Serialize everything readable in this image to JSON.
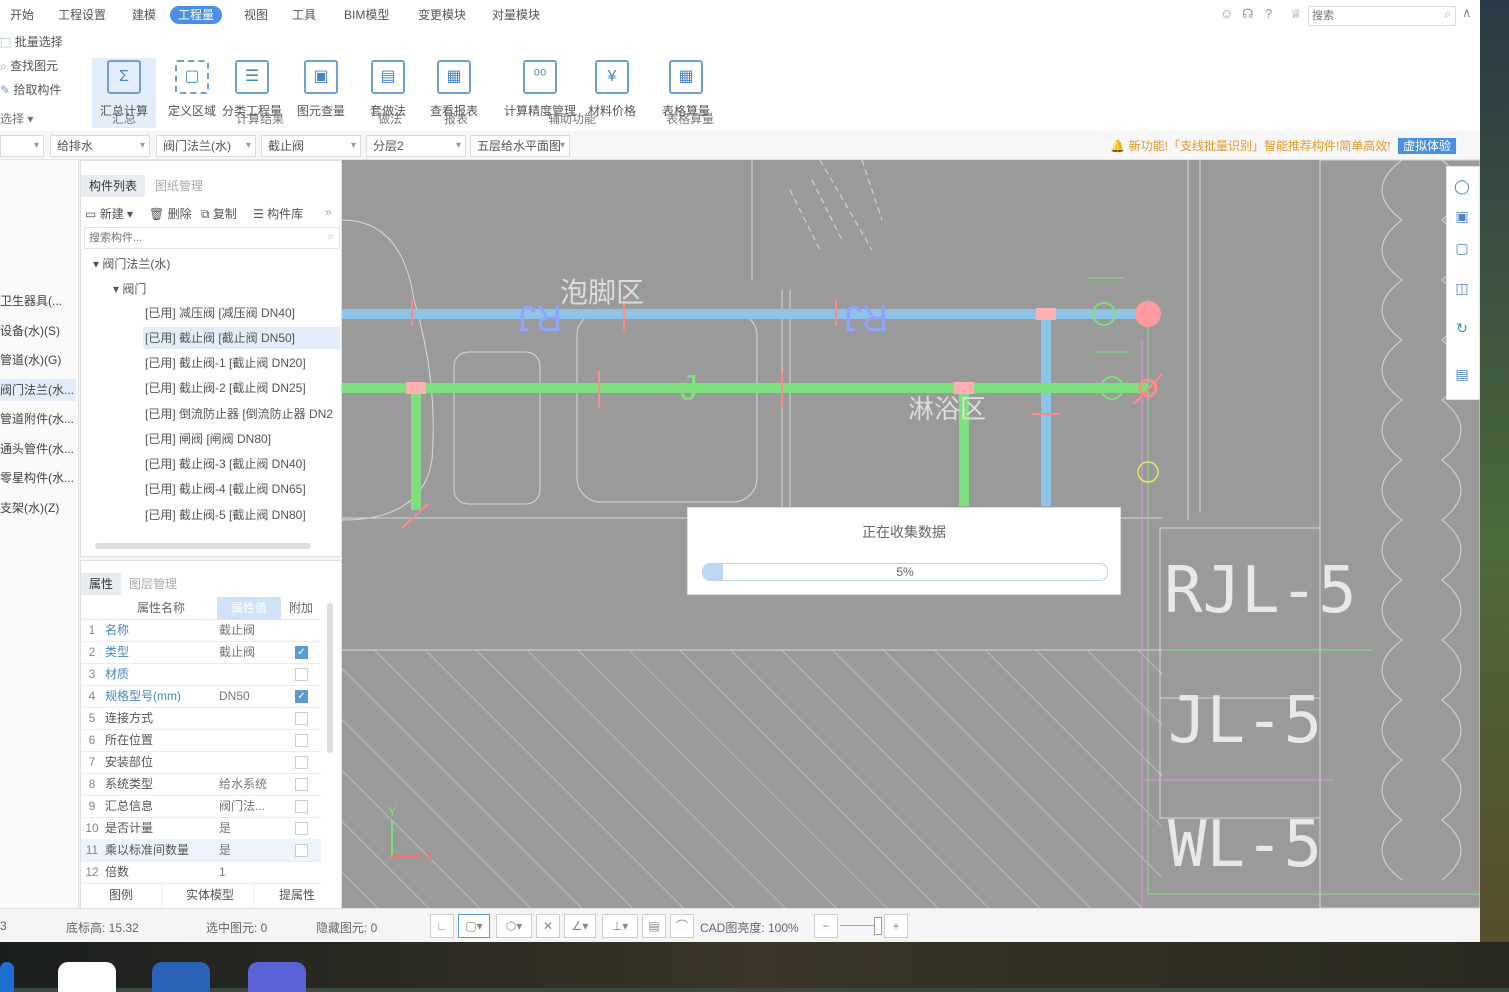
{
  "menu": [
    "开始",
    "工程设置",
    "建模",
    "工程量",
    "视图",
    "工具",
    "BIM模型",
    "变更模块",
    "对量模块"
  ],
  "active_menu": "工程量",
  "top_right": {
    "search_placeholder": "搜索",
    "icons": [
      "user-icon",
      "headset-icon",
      "help-icon",
      "skin-icon",
      "collapse-icon"
    ]
  },
  "ribbon": {
    "left_actions": [
      "批量选择",
      "查找图元",
      "拾取构件"
    ],
    "left_group": "选择",
    "buttons": [
      {
        "label": "汇总计算",
        "icon": "sigma-icon",
        "glyph": "Σ",
        "selected": true
      },
      {
        "label": "定义区域",
        "icon": "dashed-region-icon",
        "glyph": "▢",
        "selected": false
      },
      {
        "label": "分类工程量",
        "icon": "list-icon",
        "glyph": "☰",
        "selected": false
      },
      {
        "label": "图元查量",
        "icon": "element-query-icon",
        "glyph": "▣",
        "selected": false
      },
      {
        "label": "套做法",
        "icon": "method-icon",
        "glyph": "▤",
        "selected": false
      },
      {
        "label": "查看报表",
        "icon": "report-icon",
        "glyph": "▦",
        "selected": false
      },
      {
        "label": "计算精度管理",
        "icon": "precision-icon",
        "glyph": "⁰⁰",
        "selected": false
      },
      {
        "label": "材料价格",
        "icon": "price-icon",
        "glyph": "¥",
        "selected": false
      },
      {
        "label": "表格算量",
        "icon": "table-icon",
        "glyph": "▦",
        "selected": false
      }
    ],
    "groups": [
      "汇总",
      "计算结果",
      "做法",
      "报表",
      "辅助功能",
      "表格算量"
    ]
  },
  "filters": [
    "给排水",
    "阀门法兰(水)",
    "截止阀",
    "分层2",
    "五层给水平面图"
  ],
  "notice": {
    "text": "新功能!「支线批量识别」智能推荐构件!简单高效!",
    "button": "虚拟体验"
  },
  "nav_items": [
    {
      "label": "卫生器具(...",
      "active": false
    },
    {
      "label": "设备(水)(S)",
      "active": false
    },
    {
      "label": "管道(水)(G)",
      "active": false
    },
    {
      "label": "阀门法兰(水...",
      "active": true
    },
    {
      "label": "管道附件(水...",
      "active": false
    },
    {
      "label": "通头管件(水...",
      "active": false
    },
    {
      "label": "零星构件(水...",
      "active": false
    },
    {
      "label": "支架(水)(Z)",
      "active": false
    }
  ],
  "component_panel": {
    "tabs": [
      "构件列表",
      "图纸管理"
    ],
    "tools": [
      "新建",
      "删除",
      "复制",
      "构件库"
    ],
    "search_placeholder": "搜索构件...",
    "tree_root": "阀门法兰(水)",
    "tree_child": "阀门",
    "items": [
      {
        "label": "[已用] 减压阀 [减压阀 DN40]",
        "selected": false
      },
      {
        "label": "[已用] 截止阀 [截止阀 DN50]",
        "selected": true
      },
      {
        "label": "[已用] 截止阀-1 [截止阀 DN20]",
        "selected": false
      },
      {
        "label": "[已用] 截止阀-2 [截止阀 DN25]",
        "selected": false
      },
      {
        "label": "[已用] 倒流防止器 [倒流防止器 DN2",
        "selected": false
      },
      {
        "label": "[已用] 闸阀 [闸阀 DN80]",
        "selected": false
      },
      {
        "label": "[已用] 截止阀-3 [截止阀 DN40]",
        "selected": false
      },
      {
        "label": "[已用] 截止阀-4 [截止阀 DN65]",
        "selected": false
      },
      {
        "label": "[已用] 截止阀-5 [截止阀 DN80]",
        "selected": false
      }
    ]
  },
  "properties": {
    "tabs": [
      "属性",
      "图层管理"
    ],
    "headers": [
      "属性名称",
      "属性值",
      "附加"
    ],
    "rows": [
      {
        "n": "1",
        "key": "名称",
        "val": "截止阀",
        "check": null,
        "blue": true
      },
      {
        "n": "2",
        "key": "类型",
        "val": "截止阀",
        "check": true,
        "blue": true
      },
      {
        "n": "3",
        "key": "材质",
        "val": "",
        "check": false,
        "blue": true
      },
      {
        "n": "4",
        "key": "规格型号(mm)",
        "val": "DN50",
        "check": true,
        "blue": true
      },
      {
        "n": "5",
        "key": "连接方式",
        "val": "",
        "check": false,
        "blue": false
      },
      {
        "n": "6",
        "key": "所在位置",
        "val": "",
        "check": false,
        "blue": false
      },
      {
        "n": "7",
        "key": "安装部位",
        "val": "",
        "check": false,
        "blue": false
      },
      {
        "n": "8",
        "key": "系统类型",
        "val": "给水系统",
        "check": false,
        "blue": false
      },
      {
        "n": "9",
        "key": "汇总信息",
        "val": "阀门法...",
        "check": false,
        "blue": false
      },
      {
        "n": "10",
        "key": "是否计量",
        "val": "是",
        "check": false,
        "blue": false
      },
      {
        "n": "11",
        "key": "乘以标准间数量",
        "val": "是",
        "check": false,
        "blue": false
      },
      {
        "n": "12",
        "key": "倍数",
        "val": "1",
        "check": null,
        "blue": false
      }
    ],
    "bottom_buttons": [
      "图例",
      "实体模型",
      "提属性"
    ]
  },
  "drawing": {
    "labels": [
      "RJ",
      "RJ",
      "J",
      "泡脚区",
      "淋浴区",
      "RJL-5",
      "JL-5",
      "WL-5"
    ],
    "colors": {
      "hot_pipe": "#8fc4ea",
      "cold_pipe": "#7ee07e",
      "point": "#ff8a8a",
      "background": "#9a9a9a",
      "line": "#d8d8d8"
    }
  },
  "progress": {
    "title": "正在收集数据",
    "percent": 5,
    "label": "5%"
  },
  "view_tools": [
    "orbit-icon",
    "3d-icon",
    "box-icon",
    "cube-icon",
    "rotate-icon",
    "list-view-icon"
  ],
  "status": {
    "left_value": "3",
    "base_elev_label": "底标高: 15.32",
    "selected_label": "选中图元: 0",
    "hidden_label": "隐藏图元: 0",
    "cad_brightness": "CAD图亮度: 100%"
  }
}
